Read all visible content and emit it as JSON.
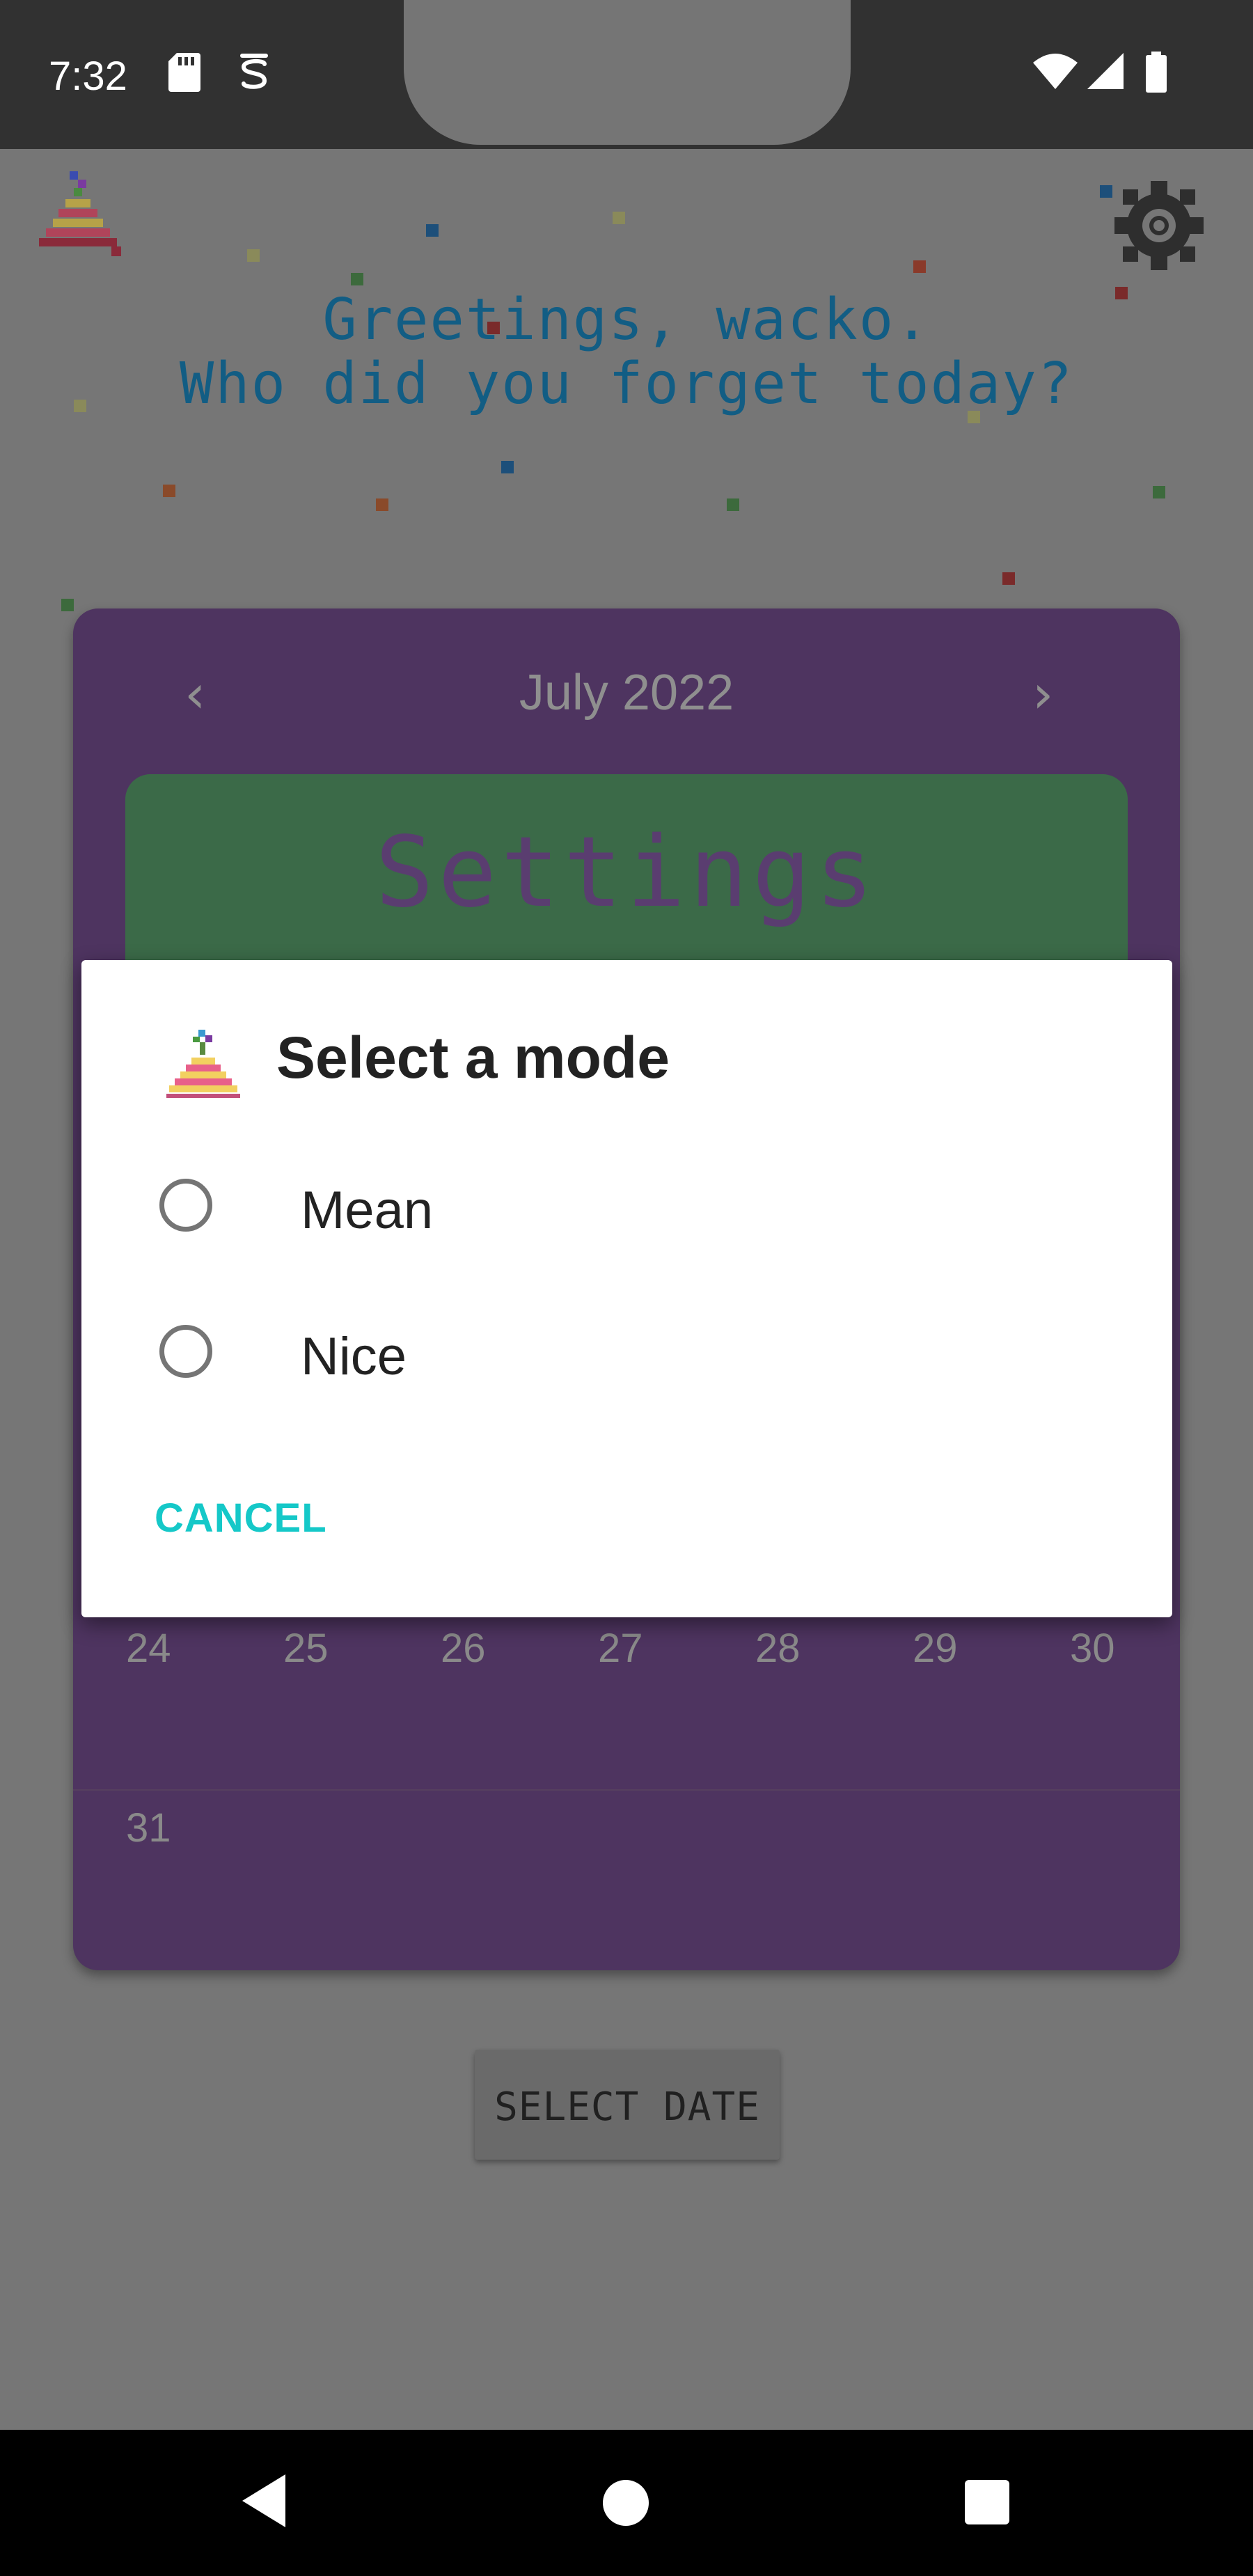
{
  "status_bar": {
    "time": "7:32",
    "left_icons": [
      "sd-card-icon",
      "vpn-s-icon"
    ],
    "right_icons": [
      "wifi-icon",
      "signal-icon",
      "battery-icon"
    ]
  },
  "app": {
    "greeting_line1": "Greetings, wacko.",
    "greeting_line2": "Who did you forget today?",
    "logo_icon": "party-cake-icon",
    "settings_icon": "gear-icon",
    "colors": {
      "greeting_text": "#125d84",
      "calendar_bg": "#4e3460",
      "settings_banner_bg": "#3b6a48",
      "dim_overlay_bg": "#767676"
    }
  },
  "calendar": {
    "month_year": "July  2022",
    "prev_icon": "chevron-left-icon",
    "next_icon": "chevron-right-icon",
    "settings_banner_label": "Settings",
    "rows": [
      [
        "24",
        "25",
        "26",
        "27",
        "28",
        "29",
        "30"
      ],
      [
        "31"
      ]
    ]
  },
  "select_date_button": {
    "label": "SELECT DATE"
  },
  "dialog": {
    "icon": "party-cake-icon",
    "title": "Select a mode",
    "options": [
      {
        "label": "Mean",
        "selected": false
      },
      {
        "label": "Nice",
        "selected": false
      }
    ],
    "cancel_label": "CANCEL",
    "accent_color": "#15c8c8"
  },
  "nav_bar": {
    "back_icon": "back-triangle-icon",
    "home_icon": "home-circle-icon",
    "recents_icon": "recents-square-icon"
  }
}
